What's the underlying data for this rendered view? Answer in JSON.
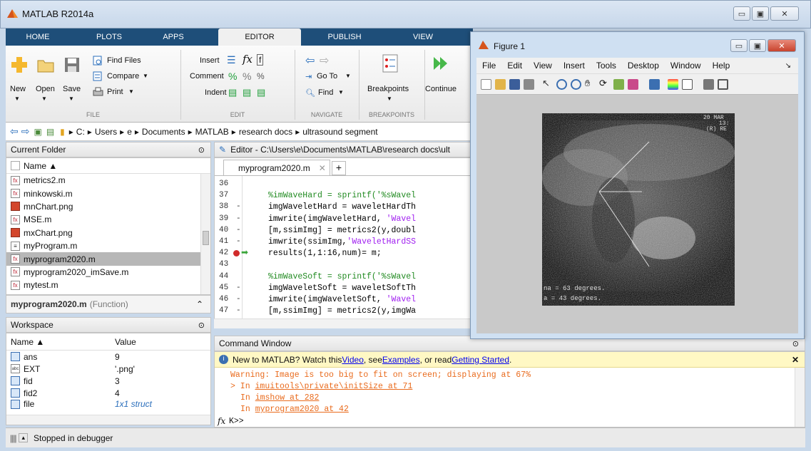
{
  "app": {
    "title": "MATLAB R2014a"
  },
  "tabs": [
    "HOME",
    "PLOTS",
    "APPS",
    "EDITOR",
    "PUBLISH",
    "VIEW"
  ],
  "ribbon": {
    "new": "New",
    "open": "Open",
    "save": "Save",
    "find_files": "Find Files",
    "compare": "Compare",
    "print": "Print",
    "insert": "Insert",
    "comment": "Comment",
    "indent": "Indent",
    "goto": "Go To",
    "find": "Find",
    "breakpoints": "Breakpoints",
    "continue": "Continue",
    "groups": {
      "file": "FILE",
      "edit": "EDIT",
      "navigate": "NAVIGATE",
      "breakpoints": "BREAKPOINTS"
    }
  },
  "path": [
    "C:",
    "Users",
    "e",
    "Documents",
    "MATLAB",
    "research docs",
    "ultrasound segment"
  ],
  "current_folder": {
    "title": "Current Folder",
    "col_name": "Name ▲",
    "files": [
      "metrics2.m",
      "minkowski.m",
      "mnChart.png",
      "MSE.m",
      "mxChart.png",
      "myProgram.m",
      "myprogram2020.m",
      "myprogram2020_imSave.m",
      "mytest.m"
    ],
    "selected": "myprogram2020.m",
    "details_name": "myprogram2020.m",
    "details_type": "(Function)"
  },
  "workspace": {
    "title": "Workspace",
    "col_name": "Name ▲",
    "col_value": "Value",
    "vars": [
      {
        "name": "ans",
        "value": "9"
      },
      {
        "name": "EXT",
        "value": "'.png'"
      },
      {
        "name": "fid",
        "value": "3"
      },
      {
        "name": "fid2",
        "value": "4"
      },
      {
        "name": "file",
        "value": "1x1 struct"
      }
    ]
  },
  "editor": {
    "title": "Editor - C:\\Users\\e\\Documents\\MATLAB\\research docs\\ult",
    "tab": "myprogram2020.m",
    "lines": [
      {
        "n": "36",
        "m": "",
        "t": ""
      },
      {
        "n": "37",
        "m": "",
        "t": "%imWaveHard = sprintf('%sWavel"
      },
      {
        "n": "38",
        "m": "-",
        "t": "imgWaveletHard = waveletHardTh"
      },
      {
        "n": "39",
        "m": "-",
        "t": "imwrite(imgWaveletHard, 'Wavel"
      },
      {
        "n": "40",
        "m": "-",
        "t": "[m,ssimImg] = metrics2(y,doubl"
      },
      {
        "n": "41",
        "m": "-",
        "t": "imwrite(ssimImg,'WaveletHardSS"
      },
      {
        "n": "42",
        "m": "",
        "t": "results(1,1:16,num)= m;"
      },
      {
        "n": "43",
        "m": "",
        "t": ""
      },
      {
        "n": "44",
        "m": "",
        "t": "%imWaveSoft = sprintf('%sWavel"
      },
      {
        "n": "45",
        "m": "-",
        "t": "imgWaveletSoft = waveletSoftTh"
      },
      {
        "n": "46",
        "m": "-",
        "t": "imwrite(imgWaveletSoft, 'Wavel"
      },
      {
        "n": "47",
        "m": "-",
        "t": "[m,ssimImg] = metrics2(y,imgWa"
      }
    ]
  },
  "command": {
    "title": "Command Window",
    "banner_pre": "New to MATLAB? Watch this ",
    "banner_video": "Video",
    "banner_mid": ", see ",
    "banner_examples": "Examples",
    "banner_mid2": ", or read ",
    "banner_gs": "Getting Started",
    "banner_end": ".",
    "warning": "Warning: Image is too big to fit on screen; displaying at 67%",
    "l1_pre": "> In ",
    "l1_link": "imuitools\\private\\initSize at 71",
    "l2_pre": "In ",
    "l2_link": "imshow at 282",
    "l3_pre": "In ",
    "l3_link": "myprogram2020 at 42",
    "prompt": "K>>",
    "fx": "fx"
  },
  "figure": {
    "title": "Figure 1",
    "menu": [
      "File",
      "Edit",
      "View",
      "Insert",
      "Tools",
      "Desktop",
      "Window",
      "Help"
    ],
    "overlay": [
      "na = 63 degrees.",
      "a = 43 degrees.",
      "20 MAR",
      "13:",
      "(R) RE"
    ]
  },
  "status": {
    "text": "Stopped in debugger"
  },
  "colors": {
    "tabbar": "#1e4e79",
    "selection": "#b7b7b7",
    "link": "#0000ee",
    "warning": "#e96b1d"
  }
}
